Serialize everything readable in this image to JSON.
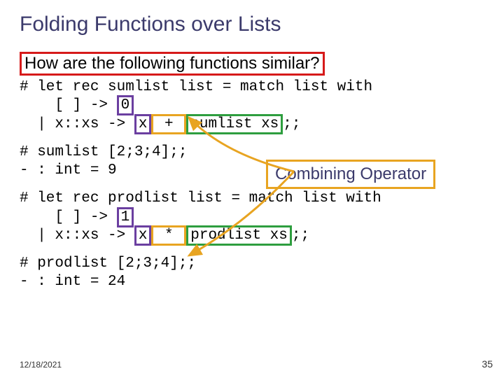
{
  "title": "Folding Functions over Lists",
  "subtitle": "How are the following functions similar?",
  "code1": {
    "l1a": "# let rec sumlist list = match list with",
    "l2a": "    [ ] -> ",
    "l2b": "0",
    "l3a": "  | x::xs -> ",
    "l3b": "x",
    "l3c": " + ",
    "l3d": "sumlist xs",
    "l3e": ";;"
  },
  "code2": {
    "l1": "# sumlist [2;3;4];;",
    "l2": "- : int = 9"
  },
  "callout": "Combining Operator",
  "code3": {
    "l1a": "# let rec prodlist list = match list with",
    "l2a": "    [ ] -> ",
    "l2b": "1",
    "l3a": "  | x::xs -> ",
    "l3b": "x",
    "l3c": " * ",
    "l3d": "prodlist xs",
    "l3e": ";;"
  },
  "code4": {
    "l1": "# prodlist [2;3;4];;",
    "l2": "- : int = 24"
  },
  "footer": {
    "date": "12/18/2021",
    "page": "35"
  }
}
